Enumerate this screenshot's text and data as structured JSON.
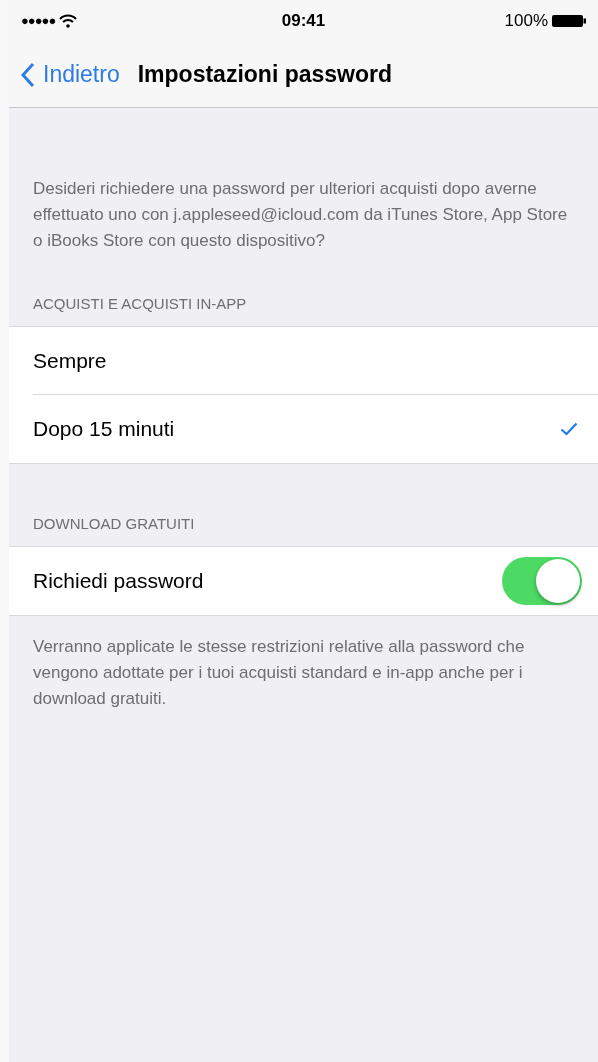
{
  "status_bar": {
    "signal_dots": "●●●●●",
    "time": "09:41",
    "battery": "100%"
  },
  "nav": {
    "back": "Indietro",
    "title": "Impostazioni password"
  },
  "description": "Desideri richiedere una password per ulteriori acquisti dopo averne effettuato uno con j.appleseed@icloud.com da iTunes Store, App Store o iBooks Store con questo dispositivo?",
  "sections": [
    {
      "header": "ACQUISTI E ACQUISTI IN-APP",
      "rows": [
        {
          "kind": "choice",
          "label": "Sempre",
          "selected": false
        },
        {
          "kind": "choice",
          "label": "Dopo 15 minuti",
          "selected": true
        }
      ]
    },
    {
      "header": "DOWNLOAD GRATUITI",
      "rows": [
        {
          "kind": "toggle",
          "label": "Richiedi password",
          "on": true
        }
      ],
      "footer": "Verranno applicate le stesse restrizioni relative alla password che vengono adottate per i tuoi acquisti standard e in-app anche per i download gratuiti."
    }
  ]
}
